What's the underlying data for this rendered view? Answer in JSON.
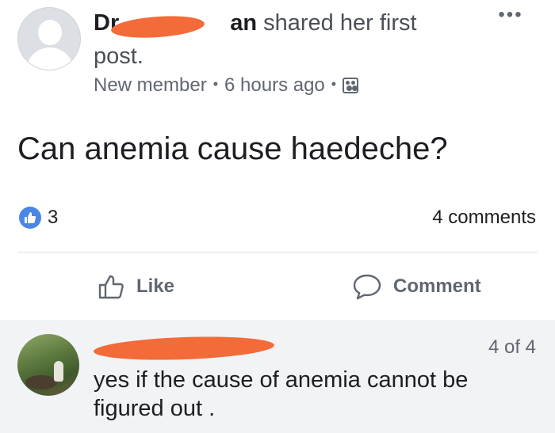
{
  "post": {
    "author_visible_prefix": "Dr",
    "author_visible_suffix": "an",
    "action_text": " shared her first post.",
    "more_label": "•••",
    "role": "New member",
    "separator": "•",
    "time": "6 hours ago",
    "body": "Can anemia cause haedeche?",
    "reaction_count": "3",
    "comments_count": "4 comments",
    "icons": {
      "more": "more-options-icon",
      "audience": "group-audience-icon",
      "reaction": "like-reaction-icon"
    }
  },
  "actions": {
    "like_label": "Like",
    "comment_label": "Comment",
    "icons": {
      "like": "thumbs-up-icon",
      "comment": "speech-bubble-icon"
    }
  },
  "comment": {
    "position": "4 of 4",
    "text": "yes if the cause of anemia cannot be figured out ."
  },
  "colors": {
    "accent": "#4a86e8",
    "redaction": "#f26b38",
    "muted_text": "#606770",
    "comment_background": "#f2f3f5"
  }
}
